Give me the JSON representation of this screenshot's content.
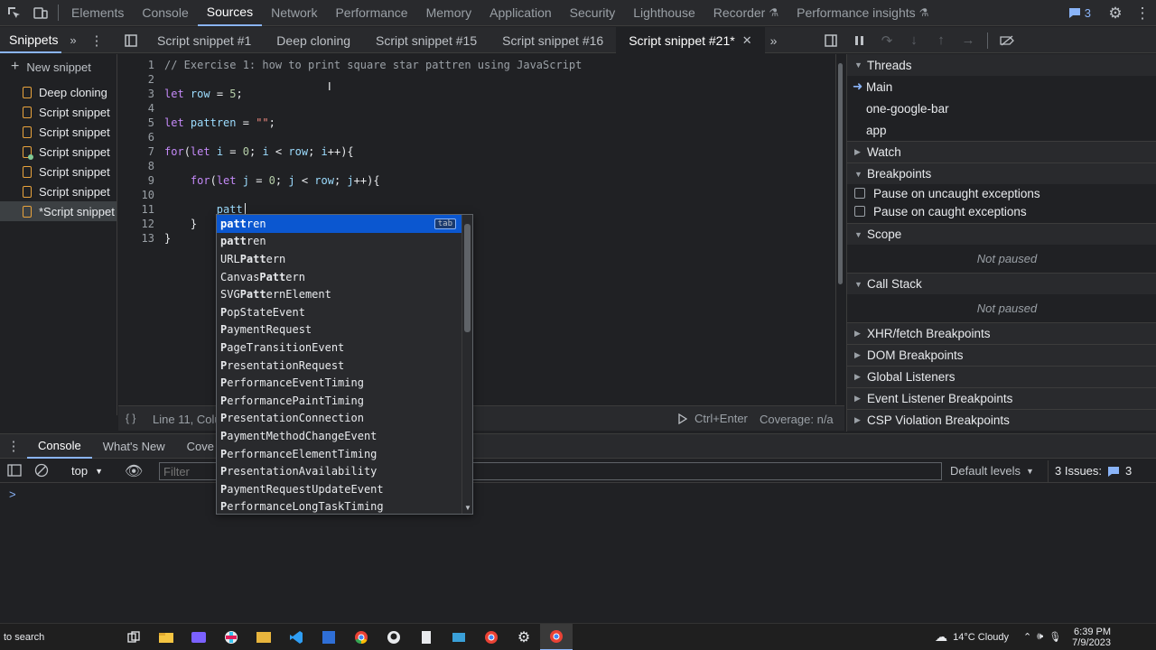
{
  "top_tabs": [
    "Elements",
    "Console",
    "Sources",
    "Network",
    "Performance",
    "Memory",
    "Application",
    "Security",
    "Lighthouse",
    "Recorder",
    "Performance insights"
  ],
  "active_top_tab": "Sources",
  "issues_count": "3",
  "navigator": {
    "tab_label": "Snippets",
    "new_snippet": "New snippet",
    "items": [
      "Deep cloning",
      "Script snippet",
      "Script snippet",
      "Script snippet",
      "Script snippet",
      "Script snippet",
      "*Script snippet"
    ]
  },
  "editor_tabs": [
    "Script snippet #1",
    "Deep cloning",
    "Script snippet #15",
    "Script snippet #16",
    "Script snippet #21*"
  ],
  "code_lines": [
    "// Exercise 1: how to print square star pattren using JavaScript",
    "",
    "let row = 5;",
    "",
    "let pattren = \"\";",
    "",
    "for(let i = 0; i < row; i++){",
    "",
    "    for(let j = 0; j < row; j++){",
    "",
    "        patt",
    "    }",
    "}"
  ],
  "status": {
    "position": "Line 11, Colu",
    "run": "Ctrl+Enter",
    "coverage": "Coverage: n/a"
  },
  "autocomplete": {
    "tab_hint": "tab",
    "items": [
      {
        "pre": "",
        "match": "patt",
        "post": "ren"
      },
      {
        "pre": "",
        "match": "patt",
        "post": "ren"
      },
      {
        "pre": "URL",
        "match": "Patt",
        "post": "ern"
      },
      {
        "pre": "Canvas",
        "match": "Patt",
        "post": "ern"
      },
      {
        "pre": "SVG",
        "match": "Patt",
        "post": "ernElement"
      },
      {
        "pre": "",
        "match": "P",
        "post": "opStateEvent"
      },
      {
        "pre": "",
        "match": "P",
        "post": "aymentRequest"
      },
      {
        "pre": "",
        "match": "P",
        "post": "ageTransitionEvent"
      },
      {
        "pre": "",
        "match": "P",
        "post": "resentationRequest"
      },
      {
        "pre": "",
        "match": "P",
        "post": "erformanceEventTiming"
      },
      {
        "pre": "",
        "match": "P",
        "post": "erformancePaintTiming"
      },
      {
        "pre": "",
        "match": "P",
        "post": "resentationConnection"
      },
      {
        "pre": "",
        "match": "P",
        "post": "aymentMethodChangeEvent"
      },
      {
        "pre": "",
        "match": "P",
        "post": "erformanceElementTiming"
      },
      {
        "pre": "",
        "match": "P",
        "post": "resentationAvailability"
      },
      {
        "pre": "",
        "match": "P",
        "post": "aymentRequestUpdateEvent"
      },
      {
        "pre": "",
        "match": "P",
        "post": "erformanceLongTaskTiming"
      }
    ]
  },
  "drawer": {
    "tabs": [
      "Console",
      "What's New",
      "Cove"
    ],
    "context": "top",
    "filter_placeholder": "Filter",
    "levels": "Default levels",
    "issues_label": "3 Issues:",
    "issues_count": "3",
    "prompt": ">"
  },
  "debugger": {
    "threads": "Threads",
    "thread_items": [
      "Main",
      "one-google-bar",
      "app"
    ],
    "watch": "Watch",
    "breakpoints": "Breakpoints",
    "pause_uncaught": "Pause on uncaught exceptions",
    "pause_caught": "Pause on caught exceptions",
    "scope": "Scope",
    "not_paused": "Not paused",
    "call_stack": "Call Stack",
    "call_not_paused": "Not paused",
    "sections": [
      "XHR/fetch Breakpoints",
      "DOM Breakpoints",
      "Global Listeners",
      "Event Listener Breakpoints",
      "CSP Violation Breakpoints"
    ]
  },
  "taskbar": {
    "search": "to search",
    "weather": "14°C  Cloudy",
    "time": "6:39 PM",
    "date": "7/9/2023"
  }
}
